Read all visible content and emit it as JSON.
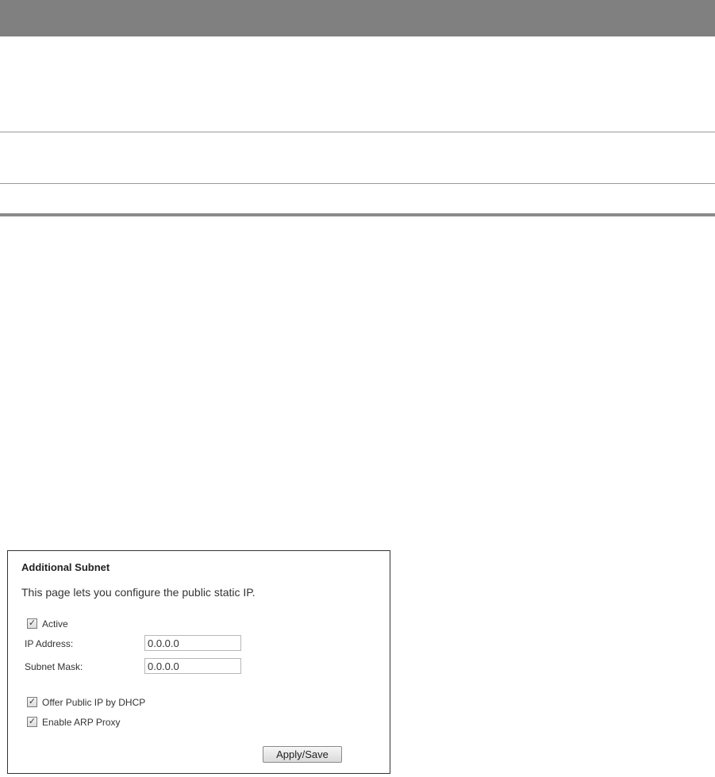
{
  "panel": {
    "title": "Additional Subnet",
    "description": "This page lets you configure the public static IP.",
    "active": {
      "label": "Active",
      "checked": true
    },
    "ip_address": {
      "label": "IP Address:",
      "value": "0.0.0.0"
    },
    "subnet_mask": {
      "label": "Subnet Mask:",
      "value": "0.0.0.0"
    },
    "offer_dhcp": {
      "label": "Offer Public IP by DHCP",
      "checked": true
    },
    "arp_proxy": {
      "label": "Enable ARP Proxy",
      "checked": true
    },
    "apply_label": "Apply/Save"
  },
  "icons": {
    "checkmark": "✓"
  }
}
